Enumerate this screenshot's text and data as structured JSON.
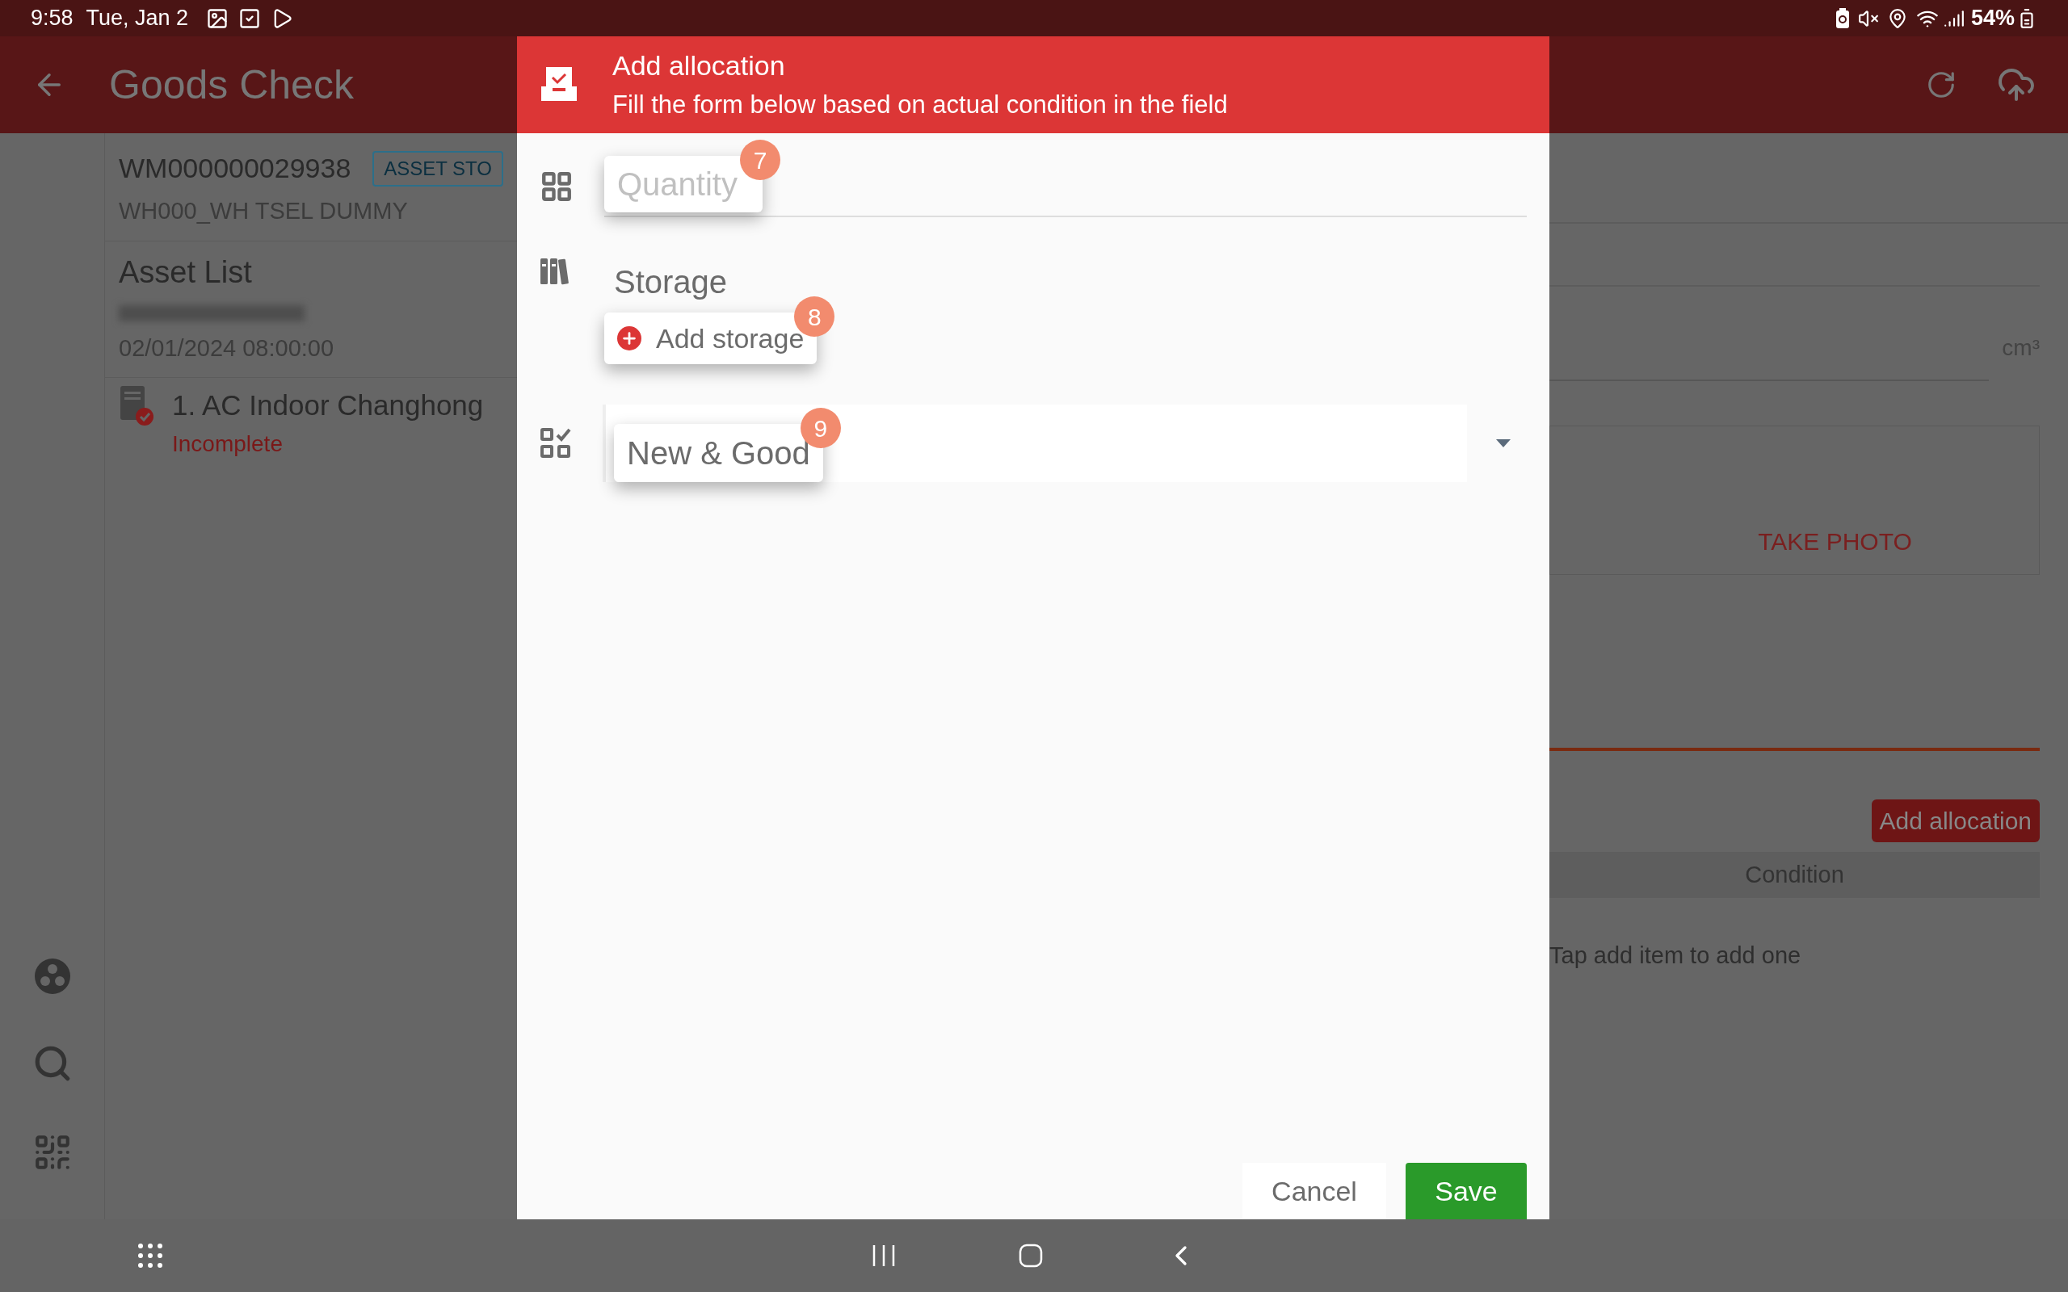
{
  "status_bar": {
    "time": "9:58",
    "date": "Tue, Jan 2",
    "battery": "54%"
  },
  "app_bar": {
    "title": "Goods Check"
  },
  "order": {
    "number": "WM000000029938",
    "tag": "ASSET STO",
    "warehouse": "WH000_WH TSEL DUMMY"
  },
  "asset_list": {
    "title": "Asset List",
    "date": "02/01/2024 08:00:00",
    "items": [
      {
        "name": "1. AC Indoor Changhong",
        "status": "Incomplete"
      }
    ]
  },
  "background_form": {
    "unit": "cm³",
    "photo_button": "TAKE PHOTO",
    "add_allocation_button": "Add allocation",
    "table_columns": [
      "Condition"
    ],
    "empty_text": "Tap add item to add one"
  },
  "dialog": {
    "title": "Add allocation",
    "subtitle": "Fill the form below based on actual condition in the field",
    "quantity": {
      "placeholder": "Quantity",
      "step": "7"
    },
    "storage": {
      "label": "Storage",
      "add_button": "Add storage",
      "step": "8"
    },
    "condition": {
      "value": "New & Good",
      "step": "9"
    },
    "buttons": {
      "cancel": "Cancel",
      "save": "Save"
    }
  }
}
